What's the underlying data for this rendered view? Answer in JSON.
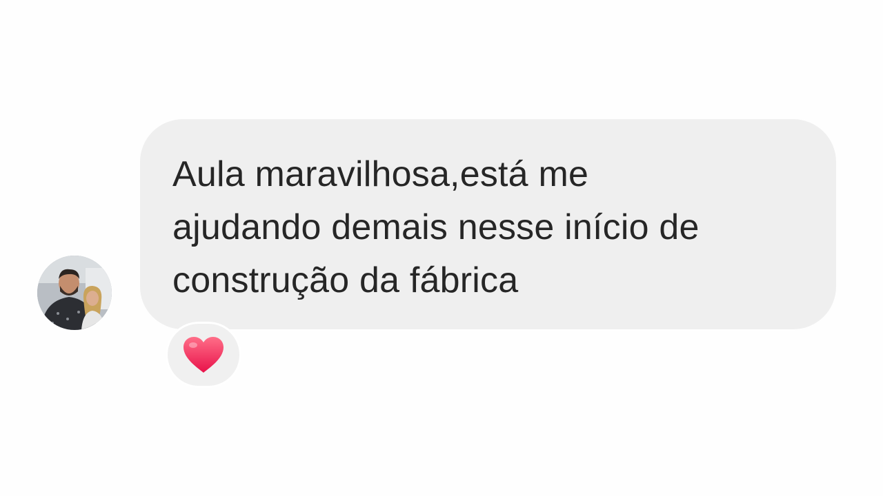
{
  "message": {
    "line1": "Aula maravilhosa,está me",
    "line2": "ajudando demais nesse início de",
    "line3": "construção da fábrica",
    "bubble_color": "#efefef",
    "text_color": "#262626"
  },
  "sender": {
    "avatar_icon": "profile-photo-avatar"
  },
  "reactions": [
    {
      "icon": "heart-icon",
      "emoji": "❤",
      "color": "#f0285a"
    }
  ]
}
